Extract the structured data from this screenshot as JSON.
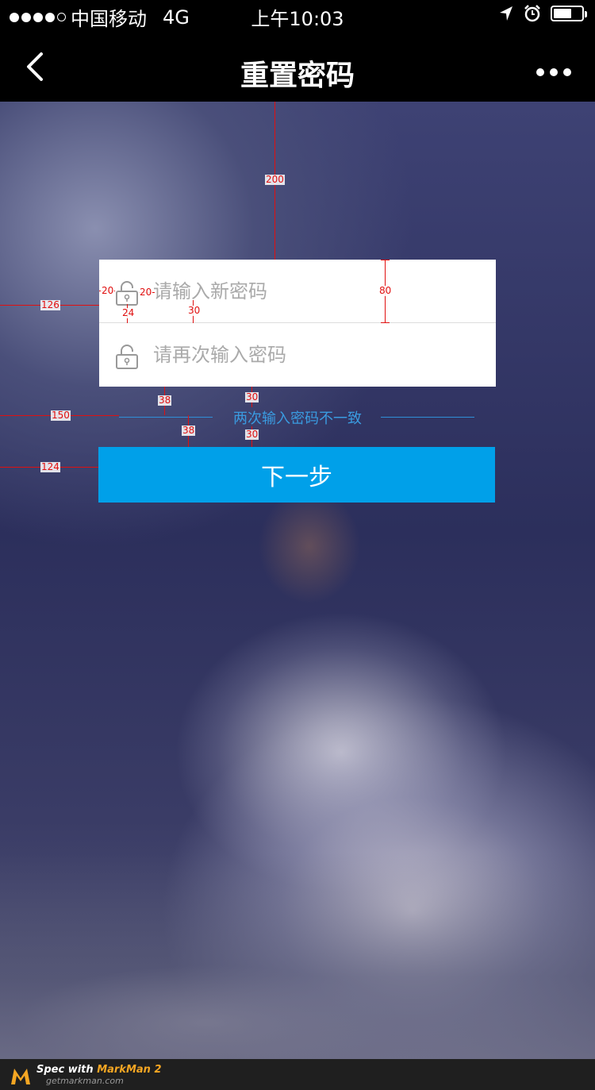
{
  "status_bar": {
    "carrier": "中国移动",
    "network": "4G",
    "time": "上午10:03"
  },
  "nav": {
    "title": "重置密码"
  },
  "form": {
    "new_password_placeholder": "请输入新密码",
    "confirm_password_placeholder": "请再次输入密码",
    "error_text": "两次输入密码不一致",
    "next_label": "下一步"
  },
  "annotations": {
    "a200": "200",
    "a80": "80",
    "a126": "126",
    "a20a": "20",
    "a20b": "20",
    "a24": "24",
    "a30a": "30",
    "a38a": "38",
    "a30b": "30",
    "a150": "150",
    "a38b": "38",
    "a30c": "30",
    "a124": "124"
  },
  "footer": {
    "brand_prefix": "Spec with ",
    "brand_name": "MarkMan 2",
    "site": "getmarkman.com"
  },
  "colors": {
    "accent": "#00a0e9",
    "error": "#3a9be0",
    "annotation": "#e01010"
  }
}
